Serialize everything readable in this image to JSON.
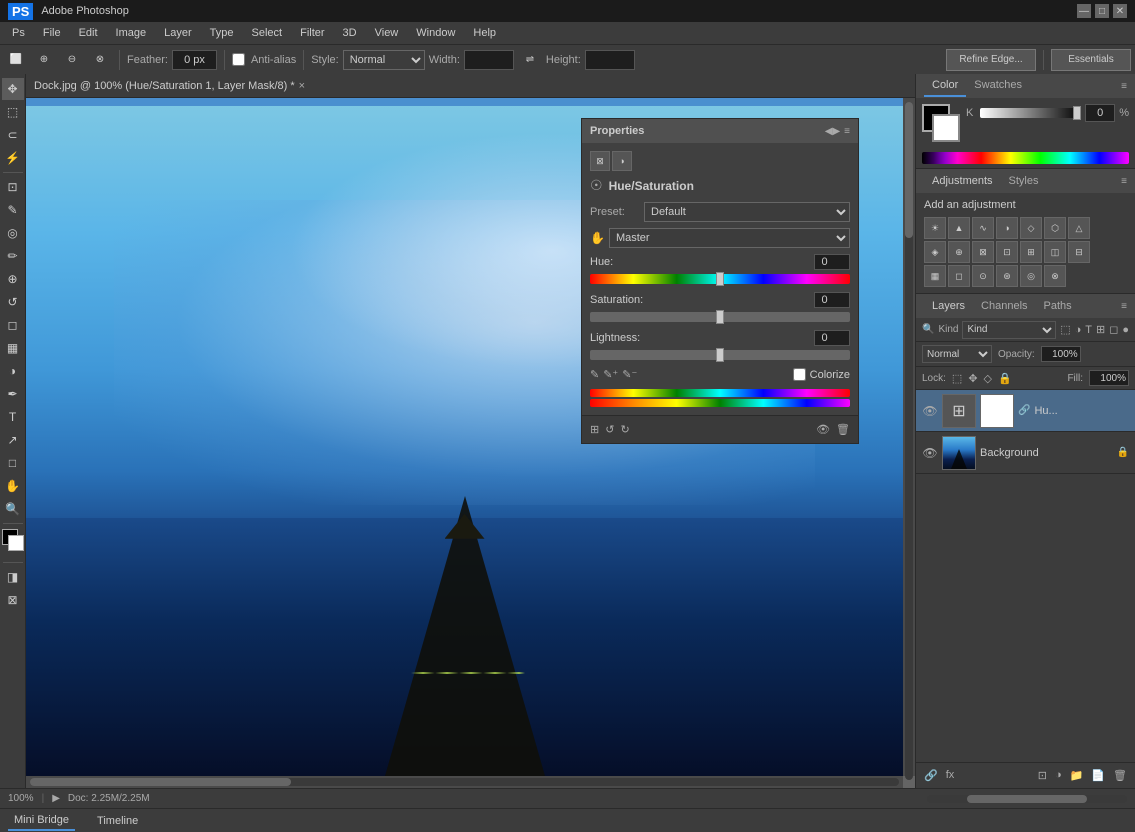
{
  "titlebar": {
    "app_name": "PS",
    "title": "Adobe Photoshop",
    "win_controls": [
      "—",
      "□",
      "✕"
    ]
  },
  "menubar": {
    "items": [
      "Ps",
      "File",
      "Edit",
      "Image",
      "Layer",
      "Type",
      "Select",
      "Filter",
      "3D",
      "View",
      "Window",
      "Help"
    ]
  },
  "toolbar": {
    "feather_label": "Feather:",
    "feather_value": "0 px",
    "antialias_label": "Anti-alias",
    "style_label": "Style:",
    "style_value": "Normal",
    "width_label": "Width:",
    "height_label": "Height:",
    "refine_edge_btn": "Refine Edge...",
    "essentials_btn": "Essentials"
  },
  "canvas_tab": {
    "filename": "Dock.jpg @ 100% (Hue/Saturation 1, Layer Mask/8) *",
    "close": "×"
  },
  "properties_panel": {
    "title": "Properties",
    "section_title": "Hue/Saturation",
    "preset_label": "Preset:",
    "preset_value": "Default",
    "channel_label": "Master",
    "hue_label": "Hue:",
    "hue_value": "0",
    "saturation_label": "Saturation:",
    "saturation_value": "0",
    "lightness_label": "Lightness:",
    "lightness_value": "0",
    "colorize_label": "Colorize"
  },
  "color_panel": {
    "color_tab": "Color",
    "swatches_tab": "Swatches",
    "k_label": "K",
    "k_value": "0",
    "percent": "%"
  },
  "adjustments_panel": {
    "adjustments_tab": "Adjustments",
    "styles_tab": "Styles",
    "title": "Add an adjustment",
    "icons": [
      "☀",
      "≋",
      "◑",
      "△",
      "◇",
      "↗",
      "▽",
      "◈",
      "⊠",
      "⊡",
      "⊞",
      "◫",
      "☰",
      "⊟",
      "◻",
      "◼",
      "⊙",
      "⊛",
      "◎",
      "⊕",
      "⊗"
    ]
  },
  "layers_panel": {
    "layers_tab": "Layers",
    "channels_tab": "Channels",
    "paths_tab": "Paths",
    "kind_label": "Kind",
    "blend_mode": "Normal",
    "opacity_label": "Opacity:",
    "opacity_value": "100%",
    "lock_label": "Lock:",
    "fill_label": "Fill:",
    "fill_value": "100%",
    "layers": [
      {
        "name": "Hu...",
        "type": "adjustment",
        "visible": true,
        "has_mask": true
      },
      {
        "name": "Background",
        "type": "image",
        "visible": true,
        "locked": true
      }
    ]
  },
  "status_bar": {
    "zoom": "100%",
    "doc_size": "Doc: 2.25M/2.25M"
  },
  "bottom_bar": {
    "mini_bridge": "Mini Bridge",
    "timeline": "Timeline"
  },
  "icons": {
    "eye": "👁",
    "lock": "🔒",
    "link": "🔗",
    "search": "🔍",
    "settings": "⚙",
    "close": "✕",
    "expand": "≡",
    "arrow_right": "▶",
    "arrow_down": "▼",
    "plus": "+",
    "minus": "−",
    "refresh": "↺",
    "trash": "🗑",
    "mask": "⊡",
    "new_layer": "📄",
    "fx": "fx",
    "visibility": "●"
  }
}
